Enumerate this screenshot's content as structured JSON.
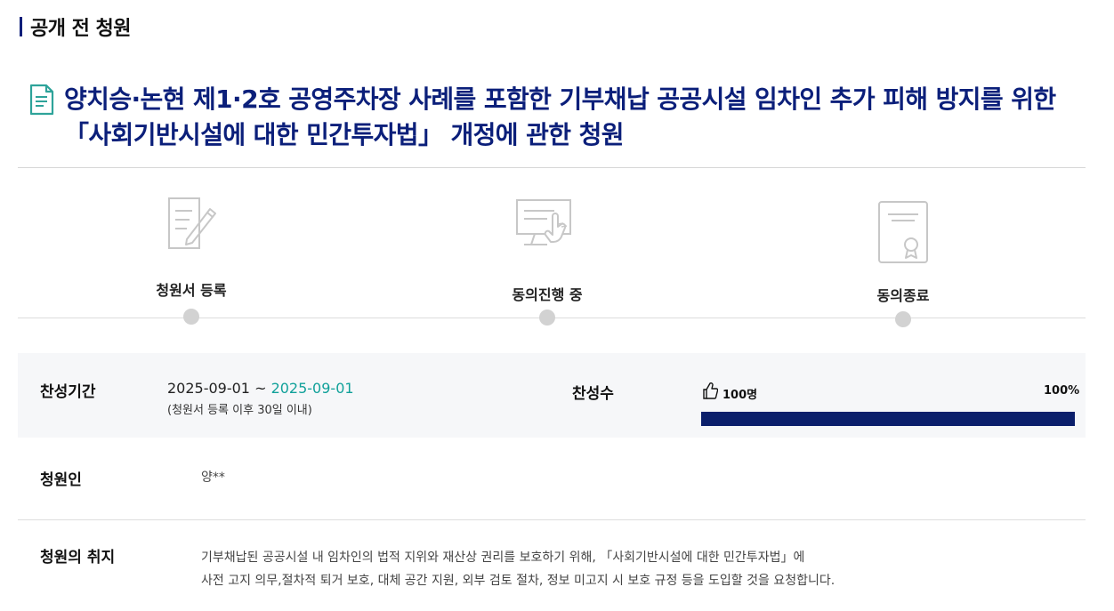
{
  "section": {
    "title": "공개 전 청원"
  },
  "petition": {
    "title": "양치승·논현 제1·2호 공영주차장 사례를 포함한 기부채납 공공시설 임차인 추가 피해 방지를 위한 「사회기반시설에 대한 민간투자법」 개정에 관한 청원"
  },
  "steps": [
    {
      "label": "청원서 등록",
      "icon": "document-pen-icon"
    },
    {
      "label": "동의진행 중",
      "icon": "monitor-touch-icon"
    },
    {
      "label": "동의종료",
      "icon": "certificate-icon"
    }
  ],
  "agree": {
    "period_label": "찬성기간",
    "start_date": "2025-09-01",
    "separator": " ~ ",
    "end_date": "2025-09-01",
    "period_note": "(청원서 등록 이후 30일 이내)",
    "count_label": "찬성수",
    "count": "100명",
    "percent": "100%",
    "progress": 1.0
  },
  "petitioner": {
    "label": "청원인",
    "value": "양**"
  },
  "purpose": {
    "label": "청원의 취지",
    "line1": "기부채납된 공공시설 내 임차인의 법적 지위와 재산상 권리를 보호하기 위해, 「사회기반시설에 대한 민간투자법」에",
    "line2": "사전 고지 의무,절차적 퇴거 보호, 대체 공간 지원, 외부 검토 절차, 정보 미고지 시 보호 규정 등을 도입할 것을 요청합니다."
  },
  "colors": {
    "accent": "#0b1f7a",
    "end_date": "#11a19a",
    "progress": "#0b1f6b"
  }
}
